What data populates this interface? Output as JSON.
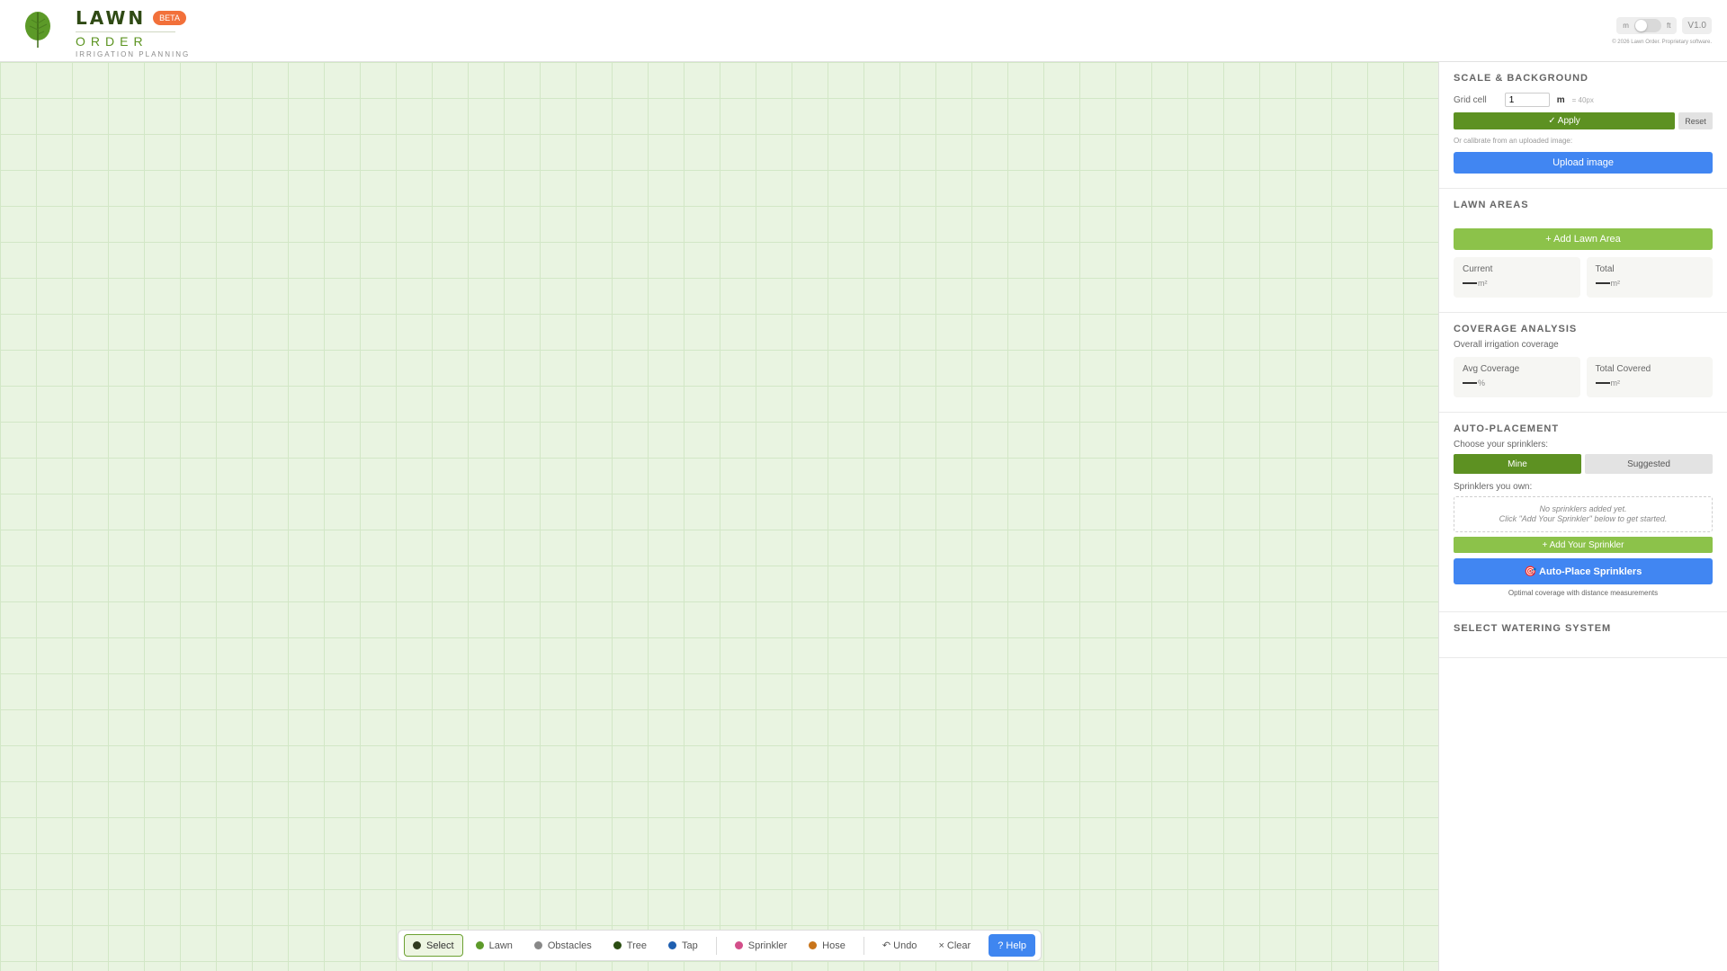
{
  "header": {
    "brand_name": "LAWN",
    "beta_badge": "BETA",
    "brand_order": "ORDER",
    "tagline": "IRRIGATION PLANNING",
    "unit_left": "m",
    "unit_right": "ft",
    "version": "V1.0",
    "copyright": "© 2026 Lawn Order. Proprietary software."
  },
  "toolbar": {
    "tools": [
      {
        "label": "Select",
        "color": "#2f3a1f"
      },
      {
        "label": "Lawn",
        "color": "#5d9a2a"
      },
      {
        "label": "Obstacles",
        "color": "#888888"
      },
      {
        "label": "Tree",
        "color": "#2b4d12"
      },
      {
        "label": "Tap",
        "color": "#1f5fb0"
      }
    ],
    "tools2": [
      {
        "label": "Sprinkler",
        "color": "#d34f8a"
      },
      {
        "label": "Hose",
        "color": "#c8741a"
      }
    ],
    "undo": "↶ Undo",
    "clear": "× Clear",
    "help": "? Help"
  },
  "sidebar": {
    "scale": {
      "title": "SCALE & BACKGROUND",
      "grid_cell_label": "Grid cell",
      "grid_cell_value": "1",
      "unit": "m",
      "px_note": "= 40px",
      "apply": "✓ Apply",
      "reset": "Reset",
      "calibrate_hint": "Or calibrate from an uploaded image:",
      "upload": "Upload image"
    },
    "lawn": {
      "title": "LAWN AREAS",
      "add": "+ Add Lawn Area",
      "current_label": "Current",
      "total_label": "Total",
      "unit": "m²"
    },
    "coverage": {
      "title": "COVERAGE ANALYSIS",
      "subtitle": "Overall irrigation coverage",
      "avg_label": "Avg Coverage",
      "avg_unit": "%",
      "covered_label": "Total Covered",
      "covered_unit": "m²"
    },
    "auto": {
      "title": "AUTO-PLACEMENT",
      "choose": "Choose your sprinklers:",
      "mine": "Mine",
      "suggested": "Suggested",
      "own_label": "Sprinklers you own:",
      "empty_line1": "No sprinklers added yet.",
      "empty_line2": "Click \"Add Your Sprinkler\" below to get started.",
      "add_sprinkler": "+ Add Your Sprinkler",
      "auto_place": "🎯 Auto-Place Sprinklers",
      "note": "Optimal coverage with distance measurements"
    },
    "watering": {
      "title": "SELECT WATERING SYSTEM"
    }
  }
}
